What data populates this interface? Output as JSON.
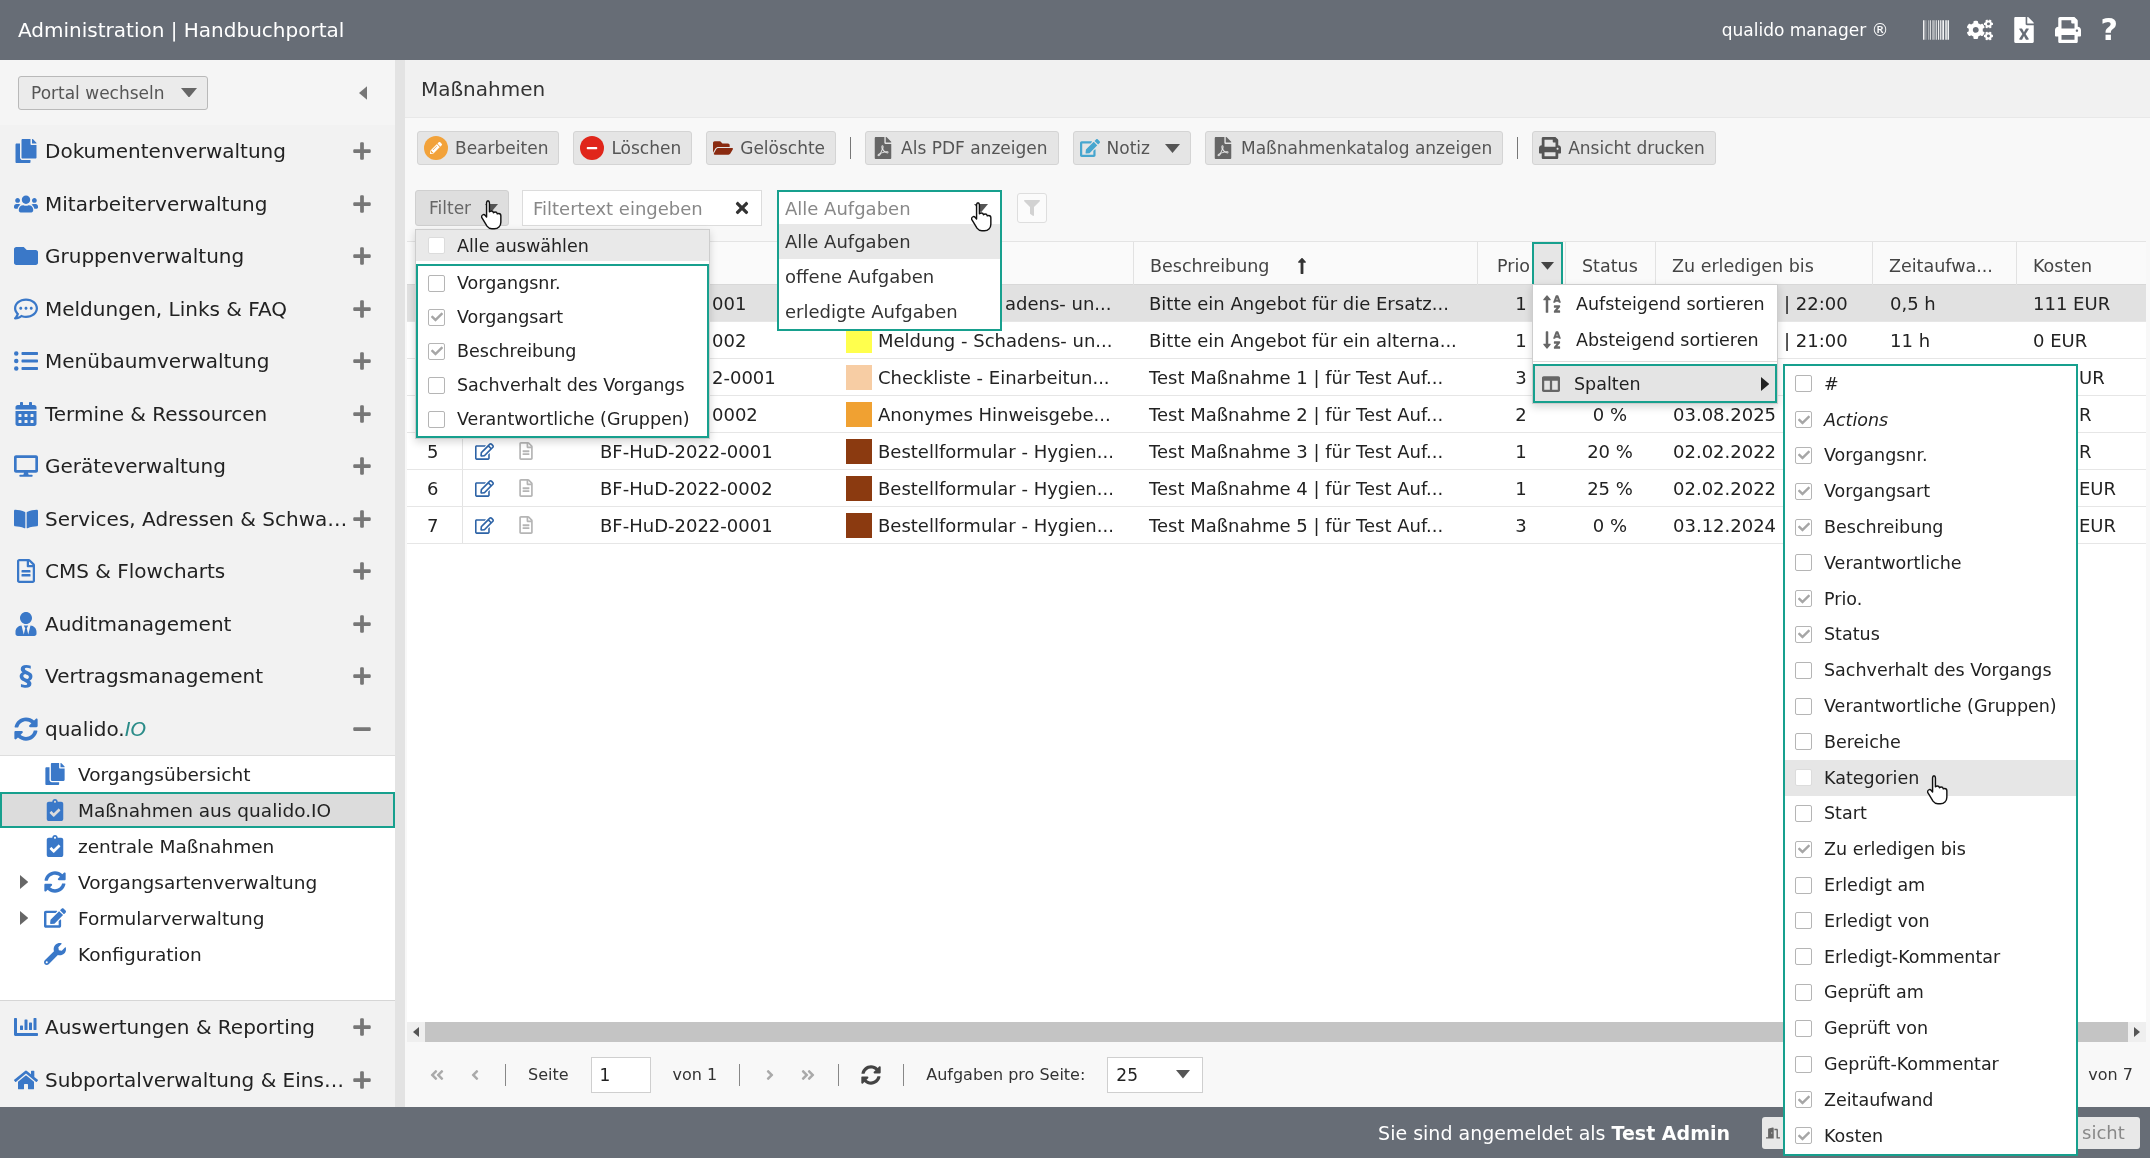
{
  "header": {
    "title": "Administration | Handbuchportal",
    "product": "qualido manager ®",
    "help": "?"
  },
  "sidebar": {
    "portal_select": "Portal wechseln",
    "items": [
      {
        "label": "Dokumentenverwaltung",
        "expanded": false
      },
      {
        "label": "Mitarbeiterverwaltung",
        "expanded": false
      },
      {
        "label": "Gruppenverwaltung",
        "expanded": false
      },
      {
        "label": "Meldungen, Links & FAQ",
        "expanded": false
      },
      {
        "label": "Menübaumverwaltung",
        "expanded": false
      },
      {
        "label": "Termine & Ressourcen",
        "expanded": false
      },
      {
        "label": "Geräteverwaltung",
        "expanded": false
      },
      {
        "label": "Services, Adressen & Schwa…",
        "expanded": false
      },
      {
        "label": "CMS & Flowcharts",
        "expanded": false
      },
      {
        "label": "Auditmanagement",
        "expanded": false
      },
      {
        "label": "Vertragsmanagement",
        "glyph": "§",
        "expanded": false
      },
      {
        "label": "qualido.*IO*",
        "expanded": true,
        "children": [
          {
            "label": "Vorgangsübersicht",
            "selected": false
          },
          {
            "label": "Maßnahmen aus qualido.IO",
            "selected": true
          },
          {
            "label": "zentrale Maßnahmen",
            "selected": false
          },
          {
            "label": "Vorgangsartenverwaltung",
            "selected": false,
            "expanded": false
          },
          {
            "label": "Formularverwaltung",
            "selected": false,
            "expanded": false
          },
          {
            "label": "Konfiguration",
            "selected": false
          }
        ]
      },
      {
        "label": "Auswertungen & Reporting",
        "expanded": false
      },
      {
        "label": "Subportalverwaltung & Eins…",
        "expanded": false
      }
    ]
  },
  "page": {
    "title": "Maßnahmen"
  },
  "toolbar": {
    "groups": [
      {
        "buttons": [
          {
            "label": "Bearbeiten"
          },
          {
            "label": "Löschen"
          },
          {
            "label": "Gelöschte"
          }
        ]
      },
      {
        "buttons": [
          {
            "label": "Als PDF anzeigen"
          },
          {
            "label": "Notiz",
            "dropdown": true
          },
          {
            "label": "Maßnahmenkatalog anzeigen"
          }
        ]
      },
      {
        "buttons": [
          {
            "label": "Ansicht drucken"
          }
        ]
      }
    ]
  },
  "filter": {
    "button": "Filter",
    "menu": {
      "select_all": {
        "label": "Alle auswählen",
        "checked": false
      },
      "items": [
        {
          "label": "Vorgangsnr.",
          "checked": false
        },
        {
          "label": "Vorgangsart",
          "checked": true
        },
        {
          "label": "Beschreibung",
          "checked": true
        },
        {
          "label": "Sachverhalt des Vorgangs",
          "checked": false
        },
        {
          "label": "Verantwortliche (Gruppen)",
          "checked": false
        }
      ]
    },
    "search": {
      "placeholder": "Filtertext eingeben"
    },
    "task_select": {
      "value": "Alle Aufgaben",
      "expanded": true,
      "options": [
        {
          "label": "Alle Aufgaben",
          "selected": true
        },
        {
          "label": "offene Aufgaben",
          "selected": false
        },
        {
          "label": "erledigte Aufgaben",
          "selected": false
        }
      ]
    }
  },
  "table": {
    "columns": [
      {
        "label": "Beschreibung",
        "sorted": true
      },
      {
        "label": "Prio",
        "menu_open": true
      },
      {
        "label": "Status"
      },
      {
        "label": "Zu erledigen bis"
      },
      {
        "label": "Zeitaufwa..."
      },
      {
        "label": "Kosten"
      }
    ],
    "column_menu": {
      "items": [
        {
          "label": "Aufsteigend sortieren",
          "highlighted": false
        },
        {
          "label": "Absteigend sortieren",
          "highlighted": false
        },
        {
          "label": "Spalten",
          "highlighted": true,
          "submenu": {
            "items": [
              {
                "label": "#",
                "kind": "column",
                "checked": false,
                "highlighted": false
              },
              {
                "label": "Actions",
                "kind": "special",
                "checked": true,
                "highlighted": false
              },
              {
                "label": "Vorgangsnr.",
                "kind": "column",
                "checked": true,
                "highlighted": false
              },
              {
                "label": "Vorgangsart",
                "kind": "column",
                "checked": true,
                "highlighted": false
              },
              {
                "label": "Beschreibung",
                "kind": "column",
                "checked": true,
                "highlighted": false
              },
              {
                "label": "Verantwortliche",
                "kind": "column",
                "checked": false,
                "highlighted": false
              },
              {
                "label": "Prio.",
                "kind": "column",
                "checked": true,
                "highlighted": false
              },
              {
                "label": "Status",
                "kind": "column",
                "checked": true,
                "highlighted": false
              },
              {
                "label": "Sachverhalt des Vorgangs",
                "kind": "column",
                "checked": false,
                "highlighted": false
              },
              {
                "label": "Verantwortliche (Gruppen)",
                "kind": "column",
                "checked": false,
                "highlighted": false
              },
              {
                "label": "Bereiche",
                "kind": "column",
                "checked": false,
                "highlighted": false
              },
              {
                "label": "Kategorien",
                "kind": "column",
                "checked": false,
                "highlighted": true
              },
              {
                "label": "Start",
                "kind": "column",
                "checked": false,
                "highlighted": false
              },
              {
                "label": "Zu erledigen bis",
                "kind": "column",
                "checked": true,
                "highlighted": false
              },
              {
                "label": "Erledigt am",
                "kind": "column",
                "checked": false,
                "highlighted": false
              },
              {
                "label": "Erledigt von",
                "kind": "column",
                "checked": false,
                "highlighted": false
              },
              {
                "label": "Erledigt-Kommentar",
                "kind": "column",
                "checked": false,
                "highlighted": false
              },
              {
                "label": "Geprüft am",
                "kind": "column",
                "checked": false,
                "highlighted": false
              },
              {
                "label": "Geprüft von",
                "kind": "column",
                "checked": false,
                "highlighted": false
              },
              {
                "label": "Geprüft-Kommentar",
                "kind": "column",
                "checked": false,
                "highlighted": false
              },
              {
                "label": "Zeitaufwand",
                "kind": "column",
                "checked": true,
                "highlighted": false
              },
              {
                "label": "Kosten",
                "kind": "column",
                "checked": true,
                "highlighted": false
              }
            ]
          }
        }
      ]
    },
    "rows": [
      {
        "selected": true,
        "vorgangsnr": "001",
        "vorgangsart": "adens- un...",
        "beschreibung": "Bitte ein Angebot für die Ersatz...",
        "prio": "1",
        "due": "| 22:00",
        "effort": "0,5 h",
        "cost": "111 EUR"
      },
      {
        "selected": false,
        "vorgangsnr": "002",
        "color": "#ffff4d",
        "vorgangsart": "Meldung - Schadens- un...",
        "beschreibung": "Bitte ein Angebot für ein alterna...",
        "prio": "1",
        "due": "| 21:00",
        "effort": "11 h",
        "cost": "0 EUR"
      },
      {
        "selected": false,
        "vorgangsnr": "2-0001",
        "color": "#f7cda4",
        "vorgangsart": "Checkliste - Einarbeitun...",
        "beschreibung": "Test Maßnahme 1 | für Test Auf...",
        "prio": "3",
        "cost": "UR"
      },
      {
        "selected": false,
        "vorgangsnr": "0002",
        "color": "#f0a132",
        "vorgangsart": "Anonymes Hinweisgebe...",
        "beschreibung": "Test Maßnahme 2 | für Test Auf...",
        "prio": "2",
        "status": "0 %",
        "due": "03.08.2025",
        "cost": "R"
      },
      {
        "selected": false,
        "number": "5",
        "vorgangsnr": "BF-HuD-2022-0001",
        "color": "#8b3a10",
        "vorgangsart": "Bestellformular - Hygien...",
        "beschreibung": "Test Maßnahme 3 | für Test Auf...",
        "prio": "1",
        "status": "20 %",
        "due": "02.02.2022",
        "cost": "R"
      },
      {
        "selected": false,
        "number": "6",
        "vorgangsnr": "BF-HuD-2022-0002",
        "color": "#8b3a10",
        "vorgangsart": "Bestellformular - Hygien...",
        "beschreibung": "Test Maßnahme 4 | für Test Auf...",
        "prio": "1",
        "status": "25 %",
        "due": "02.02.2022",
        "cost": "EUR"
      },
      {
        "selected": false,
        "number": "7",
        "vorgangsnr": "BF-HuD-2022-0001",
        "color": "#8b3a10",
        "vorgangsart": "Bestellformular - Hygien...",
        "beschreibung": "Test Maßnahme 5 | für Test Auf...",
        "prio": "3",
        "status": "0 %",
        "due": "03.12.2024",
        "cost": "EUR"
      }
    ]
  },
  "pager": {
    "page_label": "Seite",
    "page": "1",
    "total": "von 1",
    "per_page_label": "Aufgaben pro Seite:",
    "per_page": "25",
    "summary": "von 7"
  },
  "status_bar": {
    "text": "Sie sind angemeldet als **Test Admin**",
    "button": "sicht"
  }
}
